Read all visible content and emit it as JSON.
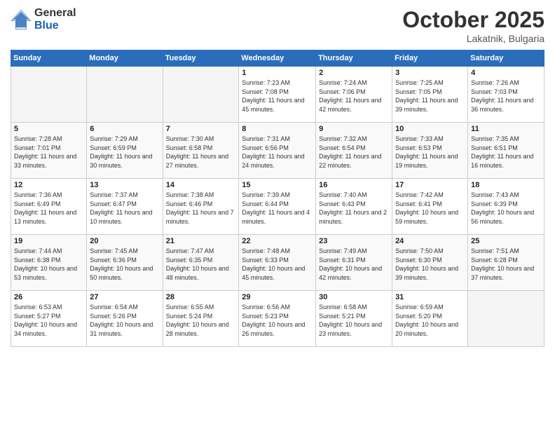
{
  "header": {
    "logo_general": "General",
    "logo_blue": "Blue",
    "month_title": "October 2025",
    "location": "Lakatnik, Bulgaria"
  },
  "weekdays": [
    "Sunday",
    "Monday",
    "Tuesday",
    "Wednesday",
    "Thursday",
    "Friday",
    "Saturday"
  ],
  "weeks": [
    [
      {
        "day": "",
        "info": ""
      },
      {
        "day": "",
        "info": ""
      },
      {
        "day": "",
        "info": ""
      },
      {
        "day": "1",
        "info": "Sunrise: 7:23 AM\nSunset: 7:08 PM\nDaylight: 11 hours and 45 minutes."
      },
      {
        "day": "2",
        "info": "Sunrise: 7:24 AM\nSunset: 7:06 PM\nDaylight: 11 hours and 42 minutes."
      },
      {
        "day": "3",
        "info": "Sunrise: 7:25 AM\nSunset: 7:05 PM\nDaylight: 11 hours and 39 minutes."
      },
      {
        "day": "4",
        "info": "Sunrise: 7:26 AM\nSunset: 7:03 PM\nDaylight: 11 hours and 36 minutes."
      }
    ],
    [
      {
        "day": "5",
        "info": "Sunrise: 7:28 AM\nSunset: 7:01 PM\nDaylight: 11 hours and 33 minutes."
      },
      {
        "day": "6",
        "info": "Sunrise: 7:29 AM\nSunset: 6:59 PM\nDaylight: 11 hours and 30 minutes."
      },
      {
        "day": "7",
        "info": "Sunrise: 7:30 AM\nSunset: 6:58 PM\nDaylight: 11 hours and 27 minutes."
      },
      {
        "day": "8",
        "info": "Sunrise: 7:31 AM\nSunset: 6:56 PM\nDaylight: 11 hours and 24 minutes."
      },
      {
        "day": "9",
        "info": "Sunrise: 7:32 AM\nSunset: 6:54 PM\nDaylight: 11 hours and 22 minutes."
      },
      {
        "day": "10",
        "info": "Sunrise: 7:33 AM\nSunset: 6:53 PM\nDaylight: 11 hours and 19 minutes."
      },
      {
        "day": "11",
        "info": "Sunrise: 7:35 AM\nSunset: 6:51 PM\nDaylight: 11 hours and 16 minutes."
      }
    ],
    [
      {
        "day": "12",
        "info": "Sunrise: 7:36 AM\nSunset: 6:49 PM\nDaylight: 11 hours and 13 minutes."
      },
      {
        "day": "13",
        "info": "Sunrise: 7:37 AM\nSunset: 6:47 PM\nDaylight: 11 hours and 10 minutes."
      },
      {
        "day": "14",
        "info": "Sunrise: 7:38 AM\nSunset: 6:46 PM\nDaylight: 11 hours and 7 minutes."
      },
      {
        "day": "15",
        "info": "Sunrise: 7:39 AM\nSunset: 6:44 PM\nDaylight: 11 hours and 4 minutes."
      },
      {
        "day": "16",
        "info": "Sunrise: 7:40 AM\nSunset: 6:43 PM\nDaylight: 11 hours and 2 minutes."
      },
      {
        "day": "17",
        "info": "Sunrise: 7:42 AM\nSunset: 6:41 PM\nDaylight: 10 hours and 59 minutes."
      },
      {
        "day": "18",
        "info": "Sunrise: 7:43 AM\nSunset: 6:39 PM\nDaylight: 10 hours and 56 minutes."
      }
    ],
    [
      {
        "day": "19",
        "info": "Sunrise: 7:44 AM\nSunset: 6:38 PM\nDaylight: 10 hours and 53 minutes."
      },
      {
        "day": "20",
        "info": "Sunrise: 7:45 AM\nSunset: 6:36 PM\nDaylight: 10 hours and 50 minutes."
      },
      {
        "day": "21",
        "info": "Sunrise: 7:47 AM\nSunset: 6:35 PM\nDaylight: 10 hours and 48 minutes."
      },
      {
        "day": "22",
        "info": "Sunrise: 7:48 AM\nSunset: 6:33 PM\nDaylight: 10 hours and 45 minutes."
      },
      {
        "day": "23",
        "info": "Sunrise: 7:49 AM\nSunset: 6:31 PM\nDaylight: 10 hours and 42 minutes."
      },
      {
        "day": "24",
        "info": "Sunrise: 7:50 AM\nSunset: 6:30 PM\nDaylight: 10 hours and 39 minutes."
      },
      {
        "day": "25",
        "info": "Sunrise: 7:51 AM\nSunset: 6:28 PM\nDaylight: 10 hours and 37 minutes."
      }
    ],
    [
      {
        "day": "26",
        "info": "Sunrise: 6:53 AM\nSunset: 5:27 PM\nDaylight: 10 hours and 34 minutes."
      },
      {
        "day": "27",
        "info": "Sunrise: 6:54 AM\nSunset: 5:26 PM\nDaylight: 10 hours and 31 minutes."
      },
      {
        "day": "28",
        "info": "Sunrise: 6:55 AM\nSunset: 5:24 PM\nDaylight: 10 hours and 28 minutes."
      },
      {
        "day": "29",
        "info": "Sunrise: 6:56 AM\nSunset: 5:23 PM\nDaylight: 10 hours and 26 minutes."
      },
      {
        "day": "30",
        "info": "Sunrise: 6:58 AM\nSunset: 5:21 PM\nDaylight: 10 hours and 23 minutes."
      },
      {
        "day": "31",
        "info": "Sunrise: 6:59 AM\nSunset: 5:20 PM\nDaylight: 10 hours and 20 minutes."
      },
      {
        "day": "",
        "info": ""
      }
    ]
  ]
}
